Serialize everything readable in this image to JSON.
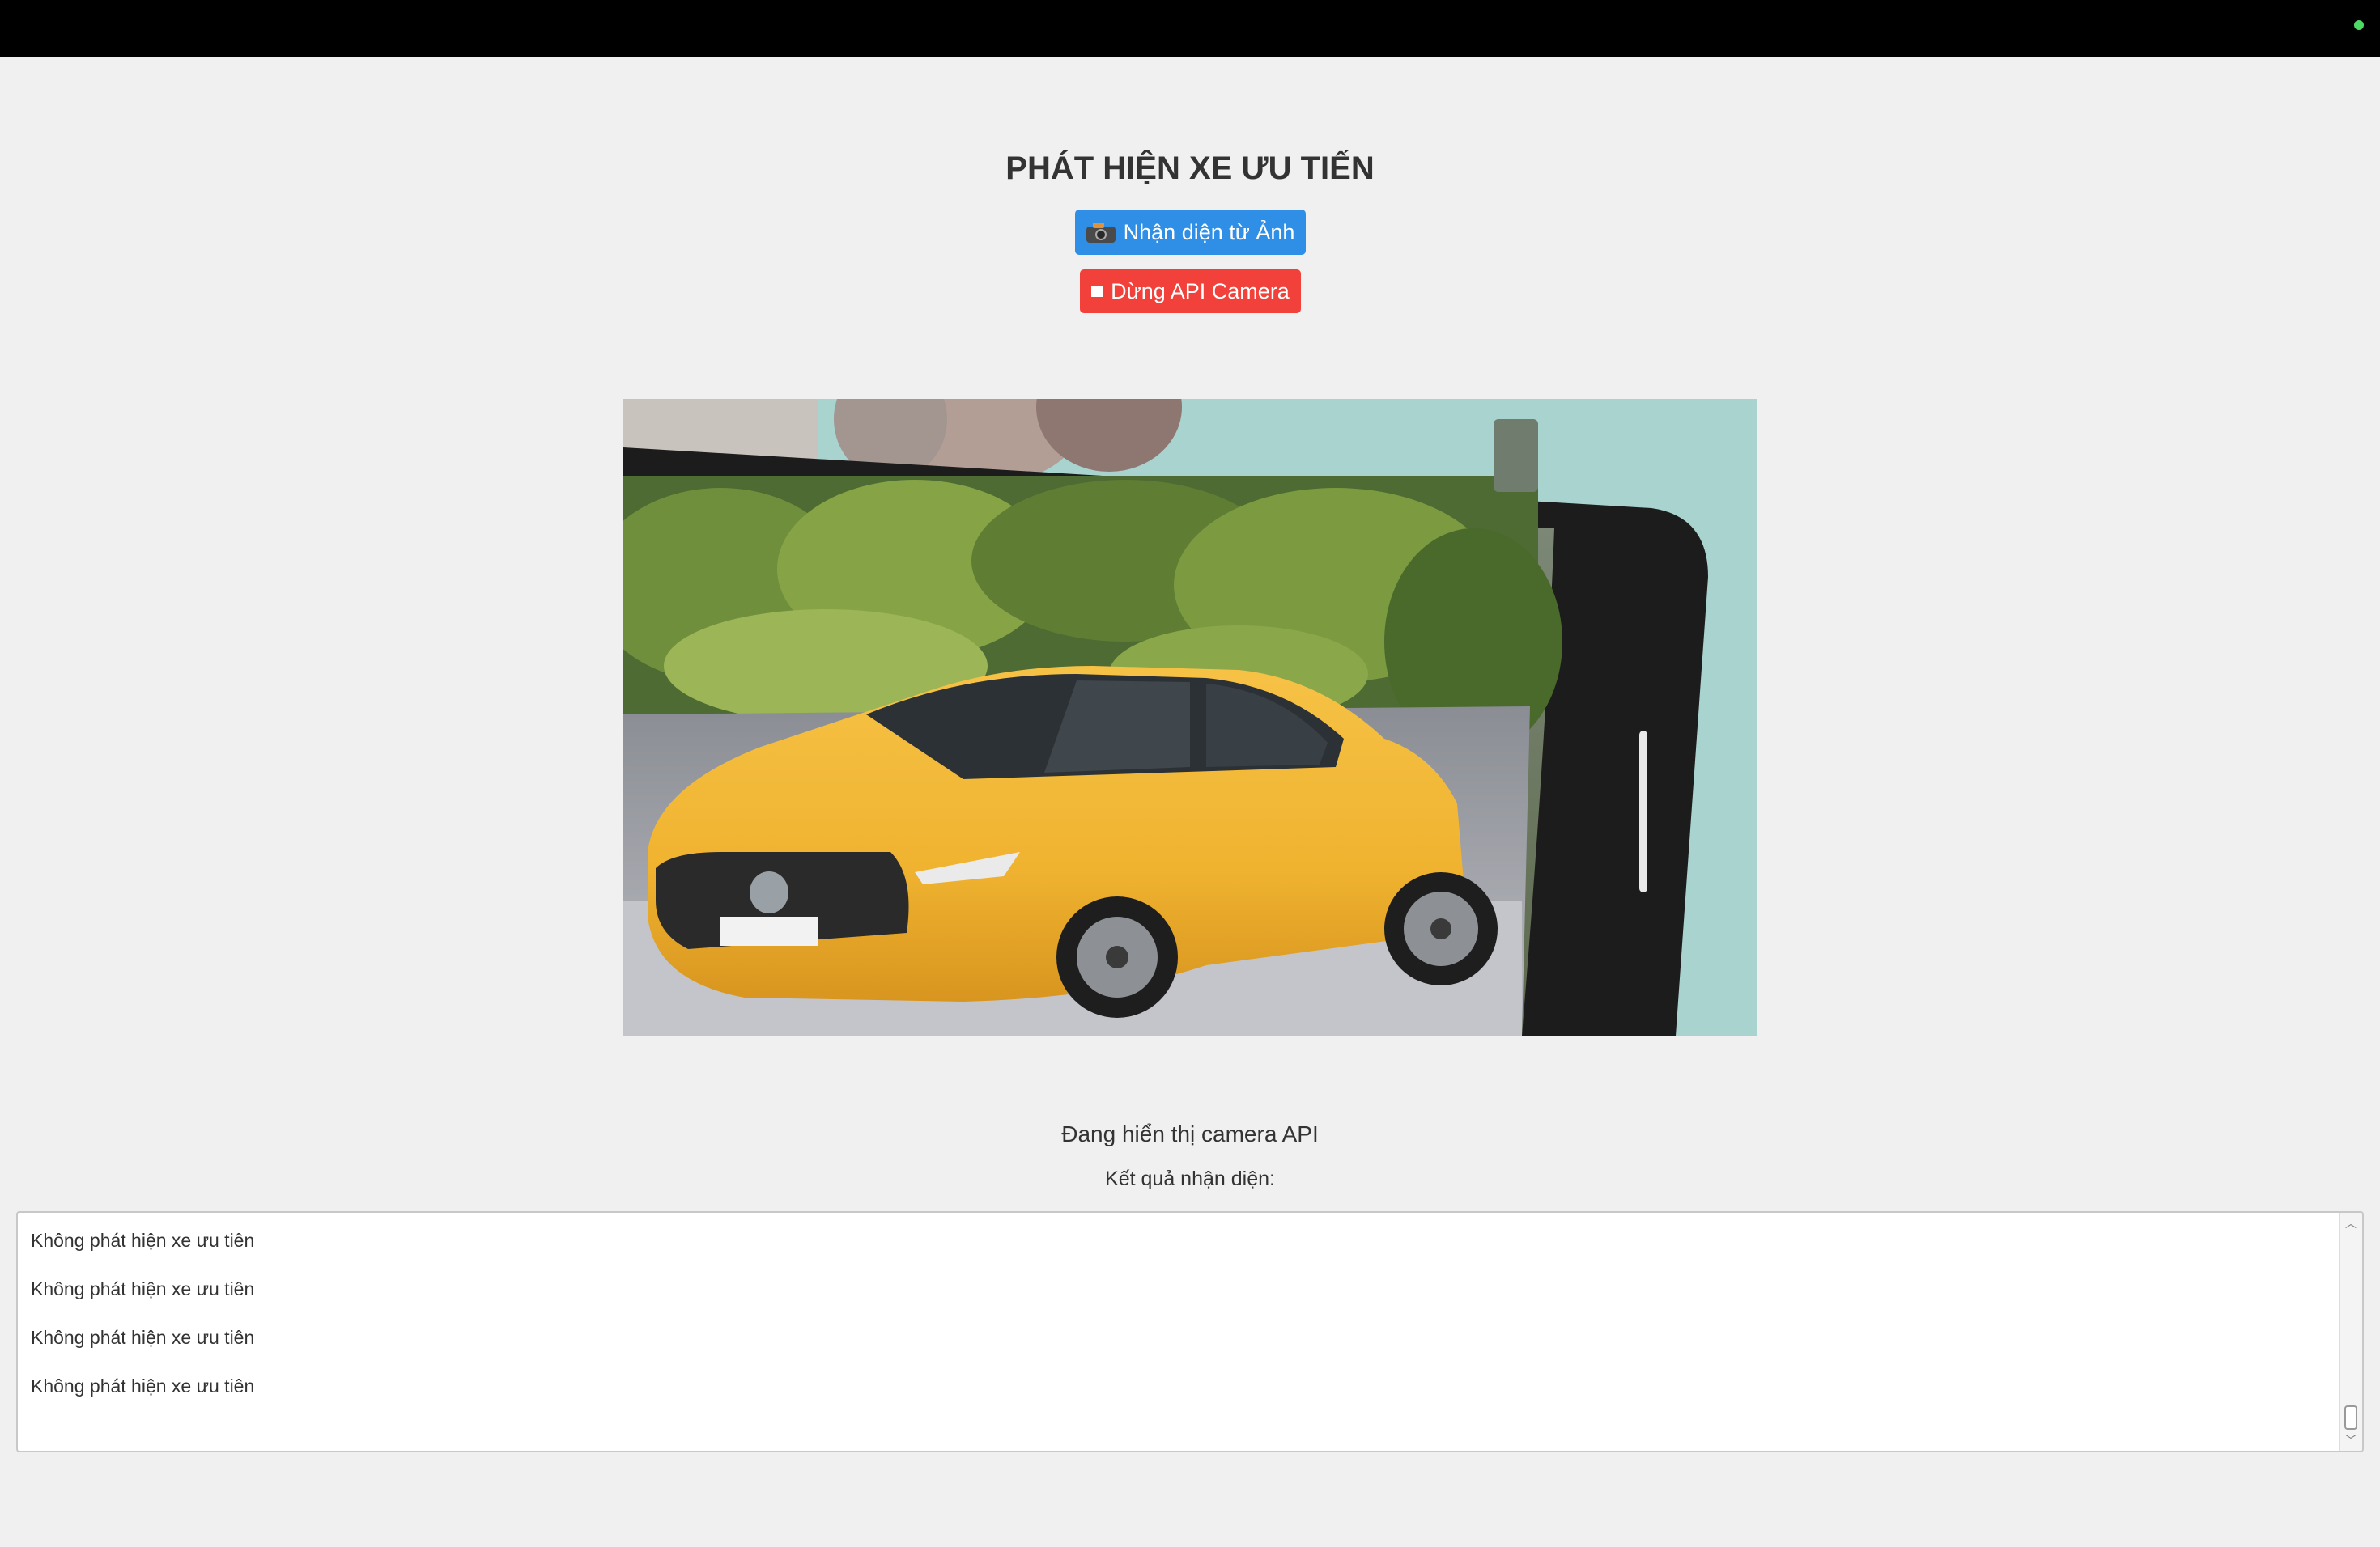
{
  "header": {
    "status_color": "#4cd964"
  },
  "page": {
    "title": "PHÁT HIỆN XE ƯU TIẾN"
  },
  "buttons": {
    "detect_label": "Nhận diện từ Ảnh",
    "detect_icon": "camera-icon",
    "detect_color": "#2f8fe6",
    "stop_label": "Dừng API Camera",
    "stop_icon": "stop-icon",
    "stop_color": "#f1413a"
  },
  "camera": {
    "status_text": "Đang hiển thị camera API"
  },
  "results": {
    "label": "Kết quả nhận diện:",
    "items": [
      "Không phát hiện xe ưu tiên",
      "Không phát hiện xe ưu tiên",
      "Không phát hiện xe ưu tiên",
      "Không phát hiện xe ưu tiên"
    ]
  }
}
